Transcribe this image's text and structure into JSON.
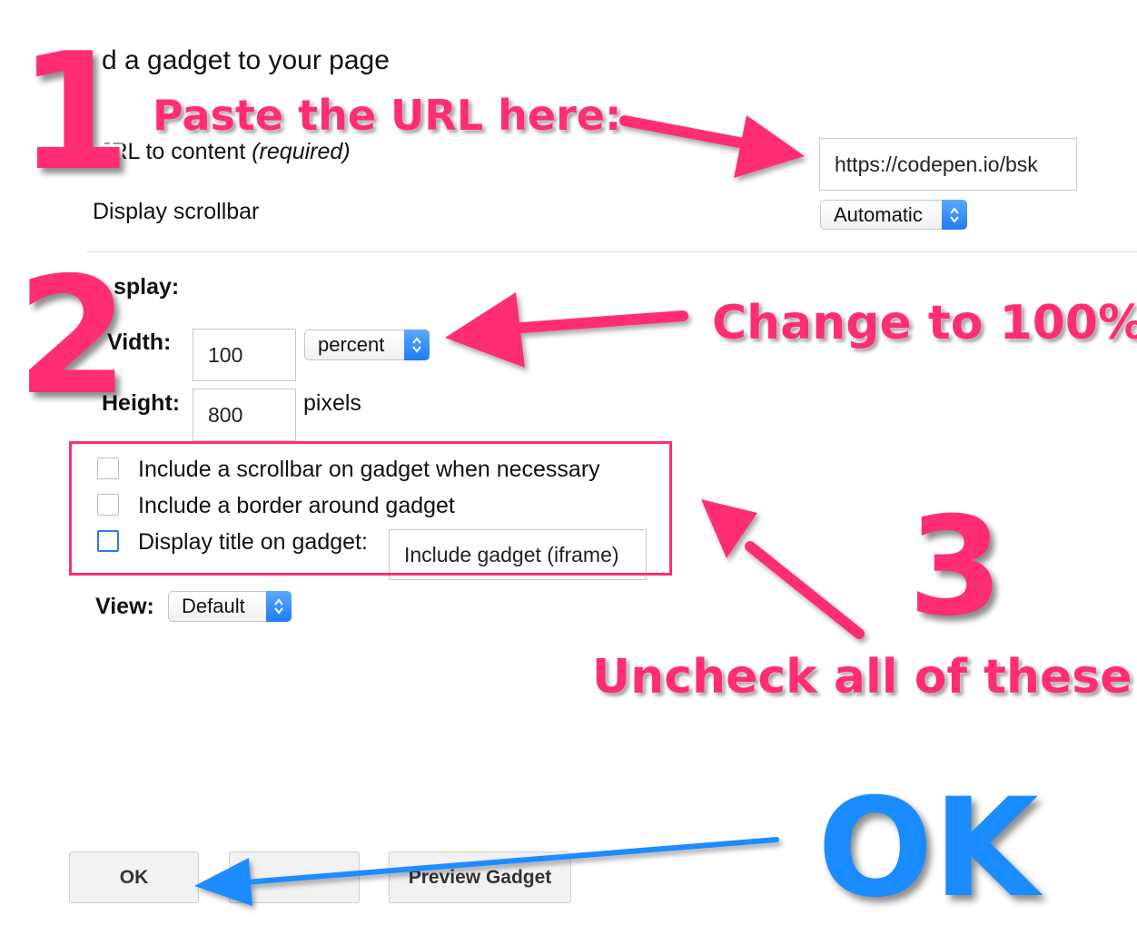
{
  "dialog": {
    "title": "d a gadget to your page",
    "url_label": "JRL to content",
    "url_required": "(required)",
    "url_value": "https://codepen.io/bsk",
    "scrollbar_label": "Display scrollbar",
    "scrollbar_value": "Automatic",
    "display_label": "splay:",
    "width_label": "Vidth:",
    "width_value": "100",
    "width_unit": "percent",
    "height_label": "Height:",
    "height_value": "800",
    "height_unit": "pixels",
    "options": [
      {
        "label": "Include a scrollbar on gadget when necessary",
        "checked": false
      },
      {
        "label": "Include a border around gadget",
        "checked": false
      },
      {
        "label": "Display title on gadget:",
        "checked": false
      }
    ],
    "gadget_title_value": "Include gadget (iframe)",
    "view_label": "View:",
    "view_value": "Default",
    "buttons": {
      "ok": "OK",
      "cancel": "",
      "preview": "Preview Gadget"
    }
  },
  "annotations": {
    "step1_number": "1",
    "step1_text": "Paste the URL here:",
    "step2_number": "2",
    "step2_text": "Change to 100%",
    "step3_number": "3",
    "step3_text": "Uncheck all of these",
    "ok_text": "OK"
  },
  "colors": {
    "annotation_pink": "#ff2d73",
    "annotation_blue": "#1a8cff",
    "select_accent": "#1f7cf2"
  }
}
